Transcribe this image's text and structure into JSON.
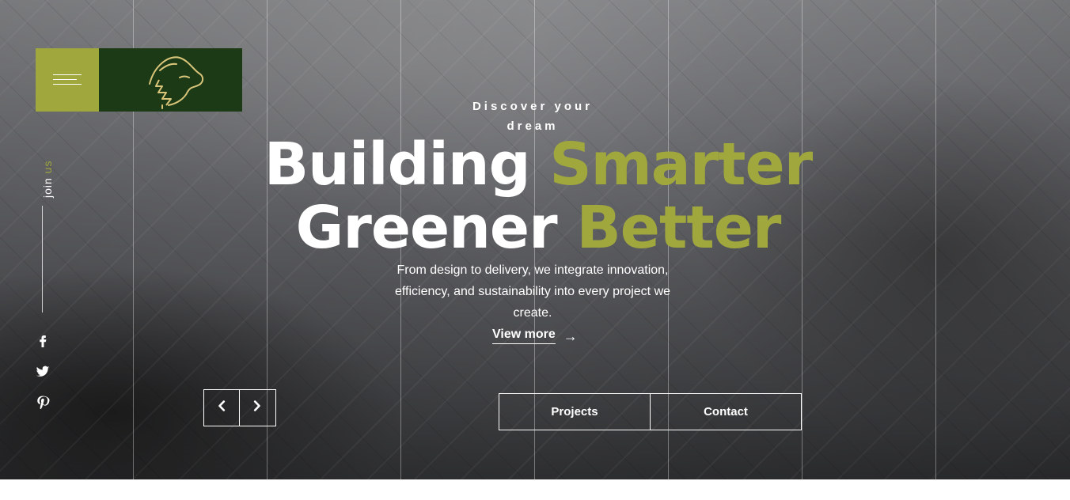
{
  "header": {
    "menu_icon": "hamburger-icon",
    "logo_icon": "panther-tree-logo"
  },
  "sidebar": {
    "join_label_1": "join",
    "join_label_2": "us",
    "social": [
      {
        "name": "facebook-icon"
      },
      {
        "name": "twitter-icon"
      },
      {
        "name": "pinterest-icon"
      }
    ]
  },
  "hero": {
    "kicker_line1": "Discover your",
    "kicker_line2": "dream",
    "headline_line1_white": "Building",
    "headline_line1_green": "Smarter",
    "headline_line2_white": "Greener",
    "headline_line2_green": "Better",
    "description": "From design to delivery, we integrate innovation, efficiency, and sustainability into every project we create.",
    "view_more": "View more",
    "view_more_icon": "arrow-right-icon"
  },
  "controls": {
    "prev_icon": "chevron-left-icon",
    "next_icon": "chevron-right-icon"
  },
  "cta": {
    "projects": "Projects",
    "contact": "Contact"
  },
  "colors": {
    "accent_green": "#a0a73d",
    "logo_green": "#1c3a16",
    "white": "#ffffff"
  }
}
